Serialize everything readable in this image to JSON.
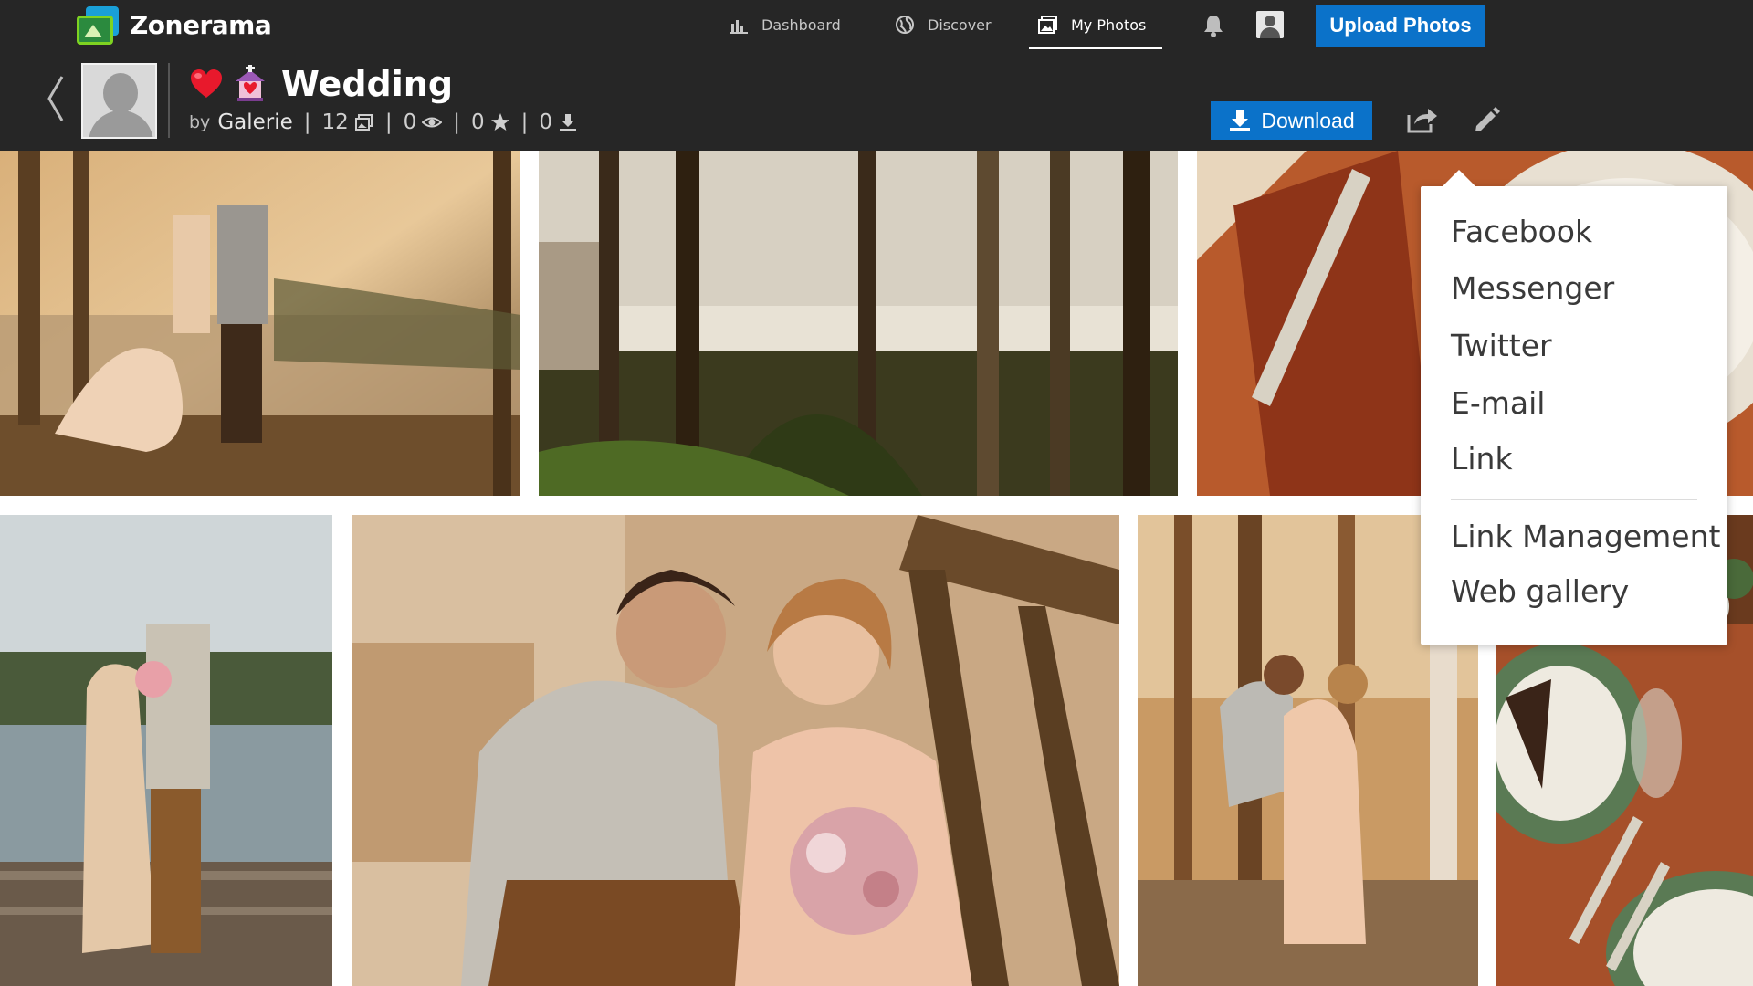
{
  "app": {
    "logo_text": "Zonerama"
  },
  "nav": {
    "items": [
      {
        "label": "Dashboard",
        "icon": "chart-icon"
      },
      {
        "label": "Discover",
        "icon": "globe-icon"
      },
      {
        "label": "My Photos",
        "icon": "photos-icon",
        "active": true
      }
    ],
    "upload_label": "Upload Photos"
  },
  "album": {
    "title": "Wedding",
    "by_label": "by",
    "author": "Galerie",
    "photo_count": "12",
    "views": "0",
    "favorites": "0",
    "downloads": "0",
    "download_label": "Download"
  },
  "share_menu": {
    "items": [
      "Facebook",
      "Messenger",
      "Twitter",
      "E-mail",
      "Link"
    ],
    "extra_items": [
      "Link Management",
      "Web gallery"
    ]
  },
  "colors": {
    "topbar": "#262626",
    "accent_blue": "#0b72c9",
    "menu_text": "#3a3a3a"
  }
}
